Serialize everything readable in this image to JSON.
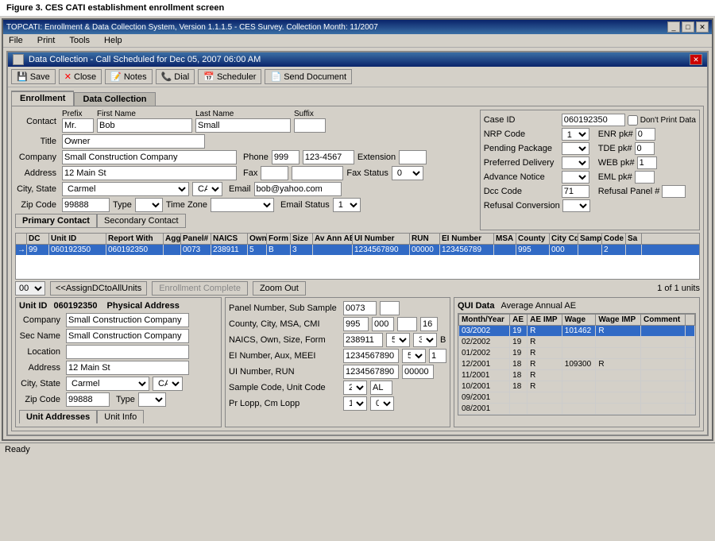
{
  "figure_caption": "Figure 3. CES CATI establishment enrollment screen",
  "app_title": "TOPCATI: Enrollment & Data Collection System, Version 1.1.1.5 - CES Survey. Collection Month: 11/2007",
  "title_buttons": [
    "_",
    "□",
    "✕"
  ],
  "menu": [
    "File",
    "Print",
    "Tools",
    "Help"
  ],
  "dialog_title": "Data Collection - Call Scheduled for Dec 05, 2007 06:00 AM",
  "toolbar": {
    "save": "Save",
    "close": "Close",
    "notes": "Notes",
    "dial": "Dial",
    "scheduler": "Scheduler",
    "send_doc": "Send Document"
  },
  "tabs": {
    "enrollment": "Enrollment",
    "data_collection": "Data Collection"
  },
  "contact": {
    "label": "Contact",
    "prefix_label": "Prefix",
    "first_name_label": "First Name",
    "last_name_label": "Last Name",
    "suffix_label": "Suffix",
    "prefix": "Mr.",
    "first_name": "Bob",
    "last_name": "Small",
    "suffix": ""
  },
  "title_field": {
    "label": "Title",
    "value": "Owner"
  },
  "company": {
    "label": "Company",
    "value": "Small Construction Company",
    "phone_label": "Phone",
    "phone": "999",
    "phone2": "123-4567",
    "ext_label": "Extension",
    "ext": ""
  },
  "address": {
    "label": "Address",
    "value": "12 Main St",
    "fax_label": "Fax",
    "fax": "",
    "fax_status_label": "Fax Status",
    "fax_status": "0"
  },
  "city_state": {
    "label": "City, State",
    "city": "Carmel",
    "state": "CA",
    "email_label": "Email",
    "email": "bob@yahoo.com"
  },
  "zip": {
    "label": "Zip Code",
    "value": "99888",
    "type_label": "Type",
    "type": "",
    "timezone_label": "Time Zone",
    "timezone": "",
    "email_status_label": "Email Status",
    "email_status": "1"
  },
  "contact_tabs": {
    "primary": "Primary Contact",
    "secondary": "Secondary Contact"
  },
  "case_panel": {
    "case_id_label": "Case ID",
    "case_id": "060192350",
    "dont_print": "Don't Print Data",
    "nrp_label": "NRP Code",
    "nrp": "1",
    "enr_pk_label": "ENR pk#",
    "enr_pk": "0",
    "pending_label": "Pending Package",
    "pending": "",
    "tde_pk_label": "TDE pk#",
    "tde_pk": "0",
    "pref_del_label": "Preferred Delivery",
    "pref_del": "",
    "web_pk_label": "WEB pk#",
    "web_pk": "1",
    "adv_notice_label": "Advance Notice",
    "adv_notice": "",
    "eml_pk_label": "EML pk#",
    "eml_pk": "",
    "dcc_label": "Dcc Code",
    "dcc": "71",
    "refusal_panel_label": "Refusal Panel #",
    "refusal_panel": "",
    "refusal_conv_label": "Refusal Conversion",
    "refusal_conv": ""
  },
  "grid_headers": [
    "DC",
    "Unit ID",
    "Report With",
    "Agg",
    "Panel#",
    "NAICS",
    "Own",
    "Form",
    "Size",
    "Av Ann AE",
    "UI Number",
    "RUN",
    "EI Number",
    "MSA",
    "County",
    "City Cd",
    "Samp",
    "Code",
    "Sa"
  ],
  "grid_row": {
    "arrow": "→",
    "dc": "99",
    "unit_id": "060192350",
    "report_with": "060192350",
    "agg": "",
    "panel": "0073",
    "naics": "238911",
    "own": "5",
    "form": "B",
    "size": "3",
    "av_ann_ae": "",
    "ui_number": "1234567890",
    "run": "00000",
    "ei_number": "123456789",
    "msa": "",
    "county": "995",
    "city_cd": "000",
    "samp": "",
    "code": "2",
    "sa": ""
  },
  "dc_select": "00",
  "assign_btn": "<<AssignDCtoAllUnits",
  "enroll_btn": "Enrollment Complete",
  "zoom_btn": "Zoom Out",
  "units_count": "1 of 1 units",
  "unit_panel": {
    "unit_id_label": "Unit ID",
    "unit_id": "060192350",
    "physical_addr_label": "Physical Address",
    "company_label": "Company",
    "company": "Small Construction Company",
    "sec_name_label": "Sec Name",
    "sec_name": "Small Construction Company",
    "location_label": "Location",
    "location": "",
    "address_label": "Address",
    "address": "12 Main St",
    "city_state_label": "City, State",
    "city": "Carmel",
    "state": "CA",
    "zip_label": "Zip Code",
    "zip": "99888",
    "type_label": "Type",
    "type": ""
  },
  "panel_section": {
    "panel_num_label": "Panel Number, Sub Sample",
    "panel_num": "0073",
    "sub_sample": "",
    "county_label": "County, City, MSA, CMI",
    "county": "995",
    "city": "000",
    "msa": "",
    "cmi": "16",
    "naics_label": "NAICS, Own, Size, Form",
    "naics": "238911",
    "own": "5",
    "size": "3",
    "form": "B",
    "ei_label": "EI Number, Aux, MEEI",
    "ei": "1234567890",
    "aux": "5",
    "meei": "1",
    "ui_label": "UI Number, RUN",
    "ui": "1234567890",
    "run": "00000",
    "sample_label": "Sample Code, Unit Code",
    "sample": "2",
    "unit_code": "AL",
    "pr_lopp_label": "Pr Lopp, Cm Lopp",
    "pr_lopp": "1",
    "cm_lopp": "0"
  },
  "qui_section": {
    "title": "QUI Data",
    "avg_annual_ae_label": "Average Annual AE",
    "headers": [
      "Month/Year",
      "AE",
      "AE IMP",
      "Wage",
      "Wage IMP",
      "Comment"
    ],
    "rows": [
      {
        "month": "03/2002",
        "ae": "19",
        "ae_imp": "R",
        "wage": "101462",
        "wage_imp": "R",
        "comment": "",
        "selected": true
      },
      {
        "month": "02/2002",
        "ae": "19",
        "ae_imp": "R",
        "wage": "",
        "wage_imp": "",
        "comment": ""
      },
      {
        "month": "01/2002",
        "ae": "19",
        "ae_imp": "R",
        "wage": "",
        "wage_imp": "",
        "comment": ""
      },
      {
        "month": "12/2001",
        "ae": "18",
        "ae_imp": "R",
        "wage": "109300",
        "wage_imp": "R",
        "comment": ""
      },
      {
        "month": "11/2001",
        "ae": "18",
        "ae_imp": "R",
        "wage": "",
        "wage_imp": "",
        "comment": ""
      },
      {
        "month": "10/2001",
        "ae": "18",
        "ae_imp": "R",
        "wage": "",
        "wage_imp": "",
        "comment": ""
      },
      {
        "month": "09/2001",
        "ae": "",
        "ae_imp": "",
        "wage": "",
        "wage_imp": "",
        "comment": ""
      },
      {
        "month": "08/2001",
        "ae": "",
        "ae_imp": "",
        "wage": "",
        "wage_imp": "",
        "comment": ""
      }
    ]
  },
  "bottom_tabs": {
    "unit_addresses": "Unit Addresses",
    "unit_info": "Unit Info"
  },
  "status_bar": "Ready"
}
